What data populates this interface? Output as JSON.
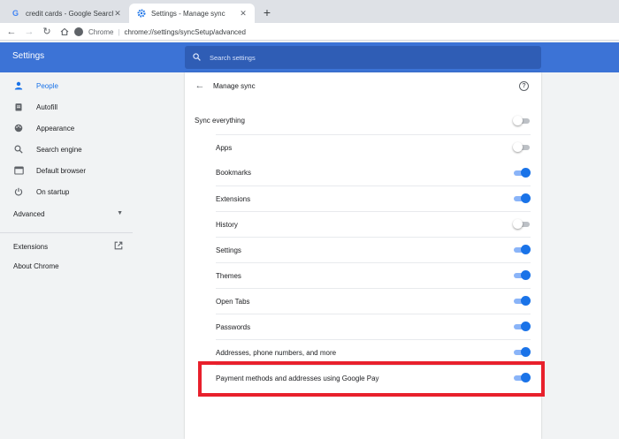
{
  "tabs": [
    {
      "title": "credit cards - Google Search",
      "favicon": "google-g-icon"
    },
    {
      "title": "Settings - Manage sync",
      "favicon": "settings-gear-icon"
    }
  ],
  "toolbar": {
    "site_label": "Chrome",
    "url": "chrome://settings/syncSetup/advanced"
  },
  "header": {
    "title": "Settings",
    "search_placeholder": "Search settings"
  },
  "sidebar": {
    "items": [
      {
        "label": "People",
        "icon": "person-icon"
      },
      {
        "label": "Autofill",
        "icon": "clipboard-icon"
      },
      {
        "label": "Appearance",
        "icon": "palette-icon"
      },
      {
        "label": "Search engine",
        "icon": "search-icon"
      },
      {
        "label": "Default browser",
        "icon": "browser-window-icon"
      },
      {
        "label": "On startup",
        "icon": "power-icon"
      }
    ],
    "advanced": "Advanced",
    "extensions": "Extensions",
    "about": "About Chrome"
  },
  "page": {
    "title": "Manage sync",
    "sync_everything": {
      "label": "Sync everything",
      "on": false
    },
    "items": [
      {
        "label": "Apps",
        "on": false
      },
      {
        "label": "Bookmarks",
        "on": true
      },
      {
        "label": "Extensions",
        "on": true
      },
      {
        "label": "History",
        "on": false
      },
      {
        "label": "Settings",
        "on": true
      },
      {
        "label": "Themes",
        "on": true
      },
      {
        "label": "Open Tabs",
        "on": true
      },
      {
        "label": "Passwords",
        "on": true
      },
      {
        "label": "Addresses, phone numbers, and more",
        "on": true
      },
      {
        "label": "Payment methods and addresses using Google Pay",
        "on": true
      }
    ]
  },
  "colors": {
    "header": "#3c73d6",
    "accent": "#1a73e8",
    "highlight": "#e8202c"
  }
}
